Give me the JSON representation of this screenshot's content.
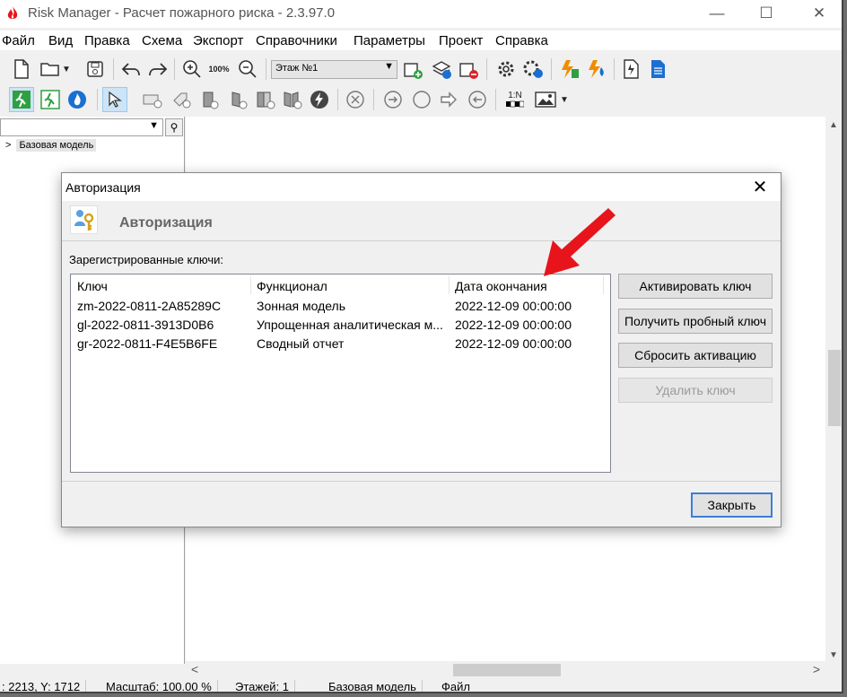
{
  "window": {
    "title": "Risk Manager - Расчет пожарного риска - 2.3.97.0",
    "minimize": "—",
    "maximize": "☐",
    "close": "✕"
  },
  "menu": [
    "Файл",
    "Вид",
    "Правка",
    "Схема",
    "Экспорт",
    "Справочники",
    "Параметры",
    "Проект",
    "Справка"
  ],
  "toolbar": {
    "zoom_label": "100%",
    "floor_select": "Этаж №1",
    "ratio_label": "1:N"
  },
  "tree": {
    "root": "Базовая модель"
  },
  "dialog": {
    "title": "Авторизация",
    "header": "Авторизация",
    "keys_label": "Зарегистрированные ключи:",
    "columns": [
      "Ключ",
      "Функционал",
      "Дата окончания"
    ],
    "rows": [
      {
        "key": "zm-2022-0811-2A85289C",
        "feature": "Зонная модель",
        "expires": "2022-12-09 00:00:00"
      },
      {
        "key": "gl-2022-0811-3913D0B6",
        "feature": "Упрощенная аналитическая м...",
        "expires": "2022-12-09 00:00:00"
      },
      {
        "key": "gr-2022-0811-F4E5B6FE",
        "feature": "Сводный отчет",
        "expires": "2022-12-09 00:00:00"
      }
    ],
    "buttons": {
      "activate": "Активировать ключ",
      "trial": "Получить пробный ключ",
      "reset": "Сбросить активацию",
      "delete": "Удалить ключ",
      "close": "Закрыть"
    }
  },
  "status": {
    "coords": ": 2213, Y: 1712",
    "scale": "Масштаб: 100.00 %",
    "floors": "Этажей: 1",
    "model": "Базовая модель",
    "file": "Файл"
  },
  "colors": {
    "accent": "#3b7dd8",
    "arrow": "#e8141b"
  }
}
